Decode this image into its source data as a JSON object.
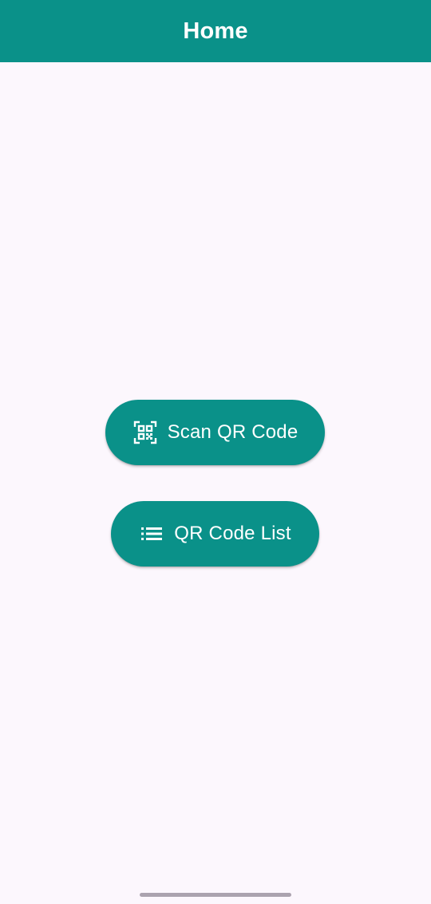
{
  "app_bar": {
    "title": "Home"
  },
  "buttons": [
    {
      "label": "Scan QR Code",
      "icon": "qr-code-scanner-icon"
    },
    {
      "label": "QR Code List",
      "icon": "list-icon"
    }
  ],
  "colors": {
    "primary": "#0A9189",
    "background": "#FCF7FD",
    "on_primary": "#FFFFFF",
    "home_indicator": "#ABA3AF"
  }
}
